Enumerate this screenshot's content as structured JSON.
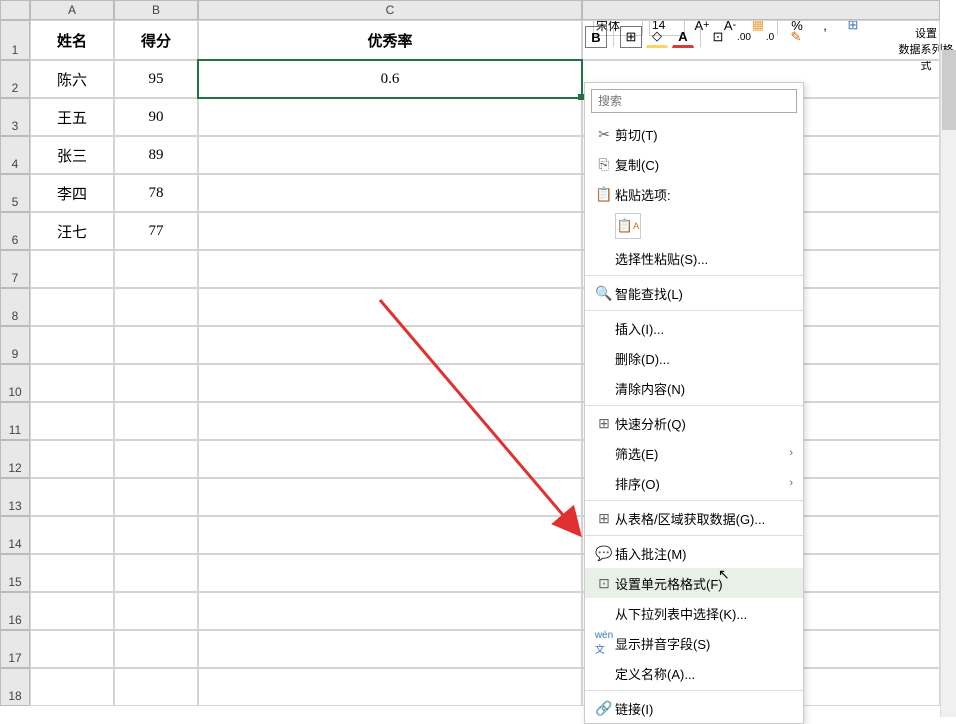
{
  "toolbar": {
    "font_name": "宋体",
    "font_size": "14",
    "settings_label": "设置",
    "data_series_label": "数据系列格式"
  },
  "columns": [
    "A",
    "B",
    "C"
  ],
  "rows": [
    {
      "n": "1",
      "A": "姓名",
      "B": "得分",
      "C": "优秀率"
    },
    {
      "n": "2",
      "A": "陈六",
      "B": "95",
      "C": "0.6"
    },
    {
      "n": "3",
      "A": "王五",
      "B": "90",
      "C": ""
    },
    {
      "n": "4",
      "A": "张三",
      "B": "89",
      "C": ""
    },
    {
      "n": "5",
      "A": "李四",
      "B": "78",
      "C": ""
    },
    {
      "n": "6",
      "A": "汪七",
      "B": "77",
      "C": ""
    },
    {
      "n": "7",
      "A": "",
      "B": "",
      "C": ""
    },
    {
      "n": "8",
      "A": "",
      "B": "",
      "C": ""
    },
    {
      "n": "9",
      "A": "",
      "B": "",
      "C": ""
    },
    {
      "n": "10",
      "A": "",
      "B": "",
      "C": ""
    },
    {
      "n": "11",
      "A": "",
      "B": "",
      "C": ""
    },
    {
      "n": "12",
      "A": "",
      "B": "",
      "C": ""
    },
    {
      "n": "13",
      "A": "",
      "B": "",
      "C": ""
    },
    {
      "n": "14",
      "A": "",
      "B": "",
      "C": ""
    },
    {
      "n": "15",
      "A": "",
      "B": "",
      "C": ""
    },
    {
      "n": "16",
      "A": "",
      "B": "",
      "C": ""
    },
    {
      "n": "17",
      "A": "",
      "B": "",
      "C": ""
    },
    {
      "n": "18",
      "A": "",
      "B": "",
      "C": ""
    }
  ],
  "context_menu": {
    "search_placeholder": "搜索",
    "cut": "剪切(T)",
    "copy": "复制(C)",
    "paste_options": "粘贴选项:",
    "paste_special": "选择性粘贴(S)...",
    "smart_lookup": "智能查找(L)",
    "insert": "插入(I)...",
    "delete": "删除(D)...",
    "clear": "清除内容(N)",
    "quick_analysis": "快速分析(Q)",
    "filter": "筛选(E)",
    "sort": "排序(O)",
    "get_data": "从表格/区域获取数据(G)...",
    "insert_comment": "插入批注(M)",
    "format_cells": "设置单元格格式(F)",
    "dropdown": "从下拉列表中选择(K)...",
    "pinyin": "显示拼音字段(S)",
    "define_name": "定义名称(A)...",
    "link": "链接(I)"
  }
}
